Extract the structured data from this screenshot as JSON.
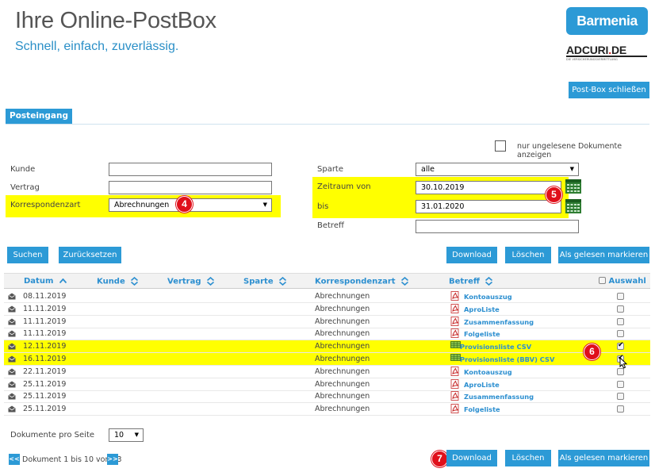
{
  "header": {
    "title": "Ihre Online-PostBox",
    "subtitle": "Schnell, einfach, zuverlässig.",
    "brand1": "Barmenia",
    "brand2_main": "ADCURI",
    "brand2_dot": ".",
    "brand2_tld": "DE",
    "brand2_sub": "DIE VERSICHERUNGSVERMITTLUNG",
    "close_button": "Post-Box schließen"
  },
  "tabs": [
    {
      "label": "Posteingang"
    }
  ],
  "filters": {
    "unread_only_label": "nur ungelesene Dokumente anzeigen",
    "kunde_label": "Kunde",
    "kunde_value": "",
    "vertrag_label": "Vertrag",
    "vertrag_value": "",
    "korrespondenzart_label": "Korrespondenzart",
    "korrespondenzart_value": "Abrechnungen",
    "sparte_label": "Sparte",
    "sparte_value": "alle",
    "zeitraum_von_label": "Zeitraum von",
    "zeitraum_von_value": "30.10.2019",
    "bis_label": "bis",
    "bis_value": "31.01.2020",
    "betreff_label": "Betreff",
    "betreff_value": ""
  },
  "badges": {
    "b4": "4",
    "b5": "5",
    "b6": "6",
    "b7": "7"
  },
  "actions": {
    "suchen": "Suchen",
    "zuruecksetzen": "Zurücksetzen",
    "download": "Download",
    "loeschen": "Löschen",
    "als_gelesen": "Als gelesen markieren"
  },
  "table": {
    "columns": {
      "datum": "Datum",
      "kunde": "Kunde",
      "vertrag": "Vertrag",
      "sparte": "Sparte",
      "korrespondenzart": "Korrespondenzart",
      "betreff": "Betreff",
      "auswahl": "Auswahl"
    },
    "rows": [
      {
        "datum": "08.11.2019",
        "korrespondenzart": "Abrechnungen",
        "betreff": "Kontoauszug",
        "file": "pdf",
        "checked": false,
        "highlight": false
      },
      {
        "datum": "11.11.2019",
        "korrespondenzart": "Abrechnungen",
        "betreff": "AproListe",
        "file": "pdf",
        "checked": false,
        "highlight": false
      },
      {
        "datum": "11.11.2019",
        "korrespondenzart": "Abrechnungen",
        "betreff": "Zusammenfassung",
        "file": "pdf",
        "checked": false,
        "highlight": false
      },
      {
        "datum": "11.11.2019",
        "korrespondenzart": "Abrechnungen",
        "betreff": "Folgeliste",
        "file": "pdf",
        "checked": false,
        "highlight": false
      },
      {
        "datum": "12.11.2019",
        "korrespondenzart": "Abrechnungen",
        "betreff": "Provisionsliste CSV",
        "file": "csv",
        "checked": true,
        "highlight": true
      },
      {
        "datum": "16.11.2019",
        "korrespondenzart": "Abrechnungen",
        "betreff": "Provisionsliste (BBV) CSV",
        "file": "csv",
        "checked": true,
        "highlight": true
      },
      {
        "datum": "22.11.2019",
        "korrespondenzart": "Abrechnungen",
        "betreff": "Kontoauszug",
        "file": "pdf",
        "checked": false,
        "highlight": false
      },
      {
        "datum": "25.11.2019",
        "korrespondenzart": "Abrechnungen",
        "betreff": "AproListe",
        "file": "pdf",
        "checked": false,
        "highlight": false
      },
      {
        "datum": "25.11.2019",
        "korrespondenzart": "Abrechnungen",
        "betreff": "Zusammenfassung",
        "file": "pdf",
        "checked": false,
        "highlight": false
      },
      {
        "datum": "25.11.2019",
        "korrespondenzart": "Abrechnungen",
        "betreff": "Folgeliste",
        "file": "pdf",
        "checked": false,
        "highlight": false
      }
    ]
  },
  "pagination": {
    "per_page_label": "Dokumente pro Seite",
    "per_page_value": "10",
    "prev": "<<",
    "next": ">>",
    "info": "Dokument 1 bis 10 von 33"
  },
  "colors": {
    "accent": "#2c9ad6",
    "highlight": "#ffff00",
    "badge": "#e0101b"
  }
}
